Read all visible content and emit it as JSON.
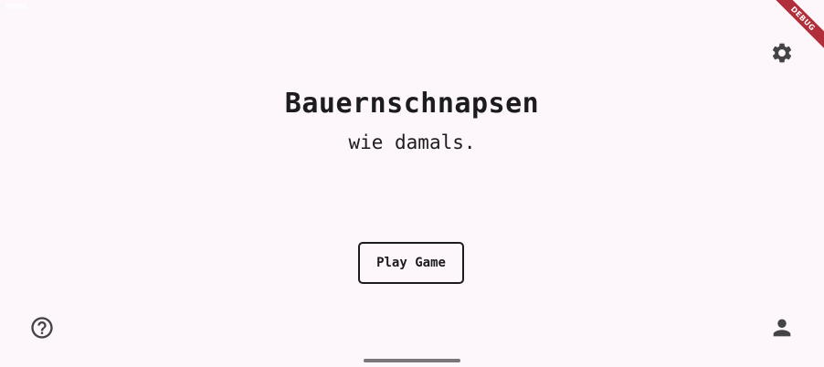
{
  "app": {
    "title": "Bauernschnapsen",
    "subtitle": "wie damals."
  },
  "buttons": {
    "play_label": "Play Game"
  },
  "icons": {
    "settings": "gear-icon",
    "help": "help-circle-icon",
    "profile": "person-icon"
  },
  "debug_banner": {
    "label": "DEBUG"
  },
  "colors": {
    "background": "#fdf7fc",
    "foreground": "#1c1b1f",
    "debug_ribbon": "#b02f3a"
  }
}
